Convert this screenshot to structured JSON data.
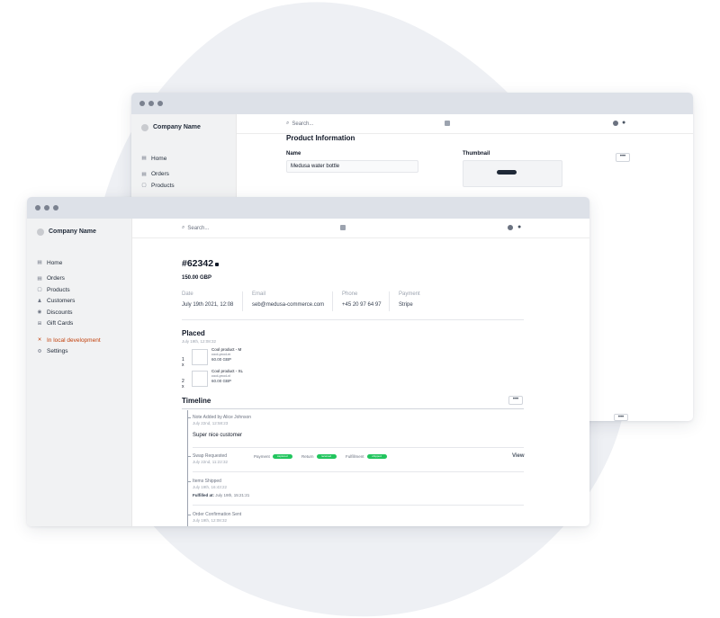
{
  "back_window": {
    "company": "Company Name",
    "search_placeholder": "Search...",
    "nav": [
      "Home",
      "Orders",
      "Products"
    ],
    "section_title": "Product Information",
    "name_label": "Name",
    "name_value": "Medusa water bottle",
    "thumbnail_label": "Thumbnail",
    "more_label": "•••"
  },
  "front_window": {
    "company": "Company Name",
    "search_placeholder": "Search...",
    "nav": {
      "home": "Home",
      "orders": "Orders",
      "products": "Products",
      "customers": "Customers",
      "discounts": "Discounts",
      "gift_cards": "Gift Cards",
      "local_dev": "In local development",
      "settings": "Settings"
    },
    "order": {
      "id": "#62342",
      "total": "150.00 GBP",
      "date_label": "Date",
      "date_value": "July 19th 2021, 12:08",
      "email_label": "Email",
      "email_value": "seb@medusa-commerce.com",
      "phone_label": "Phone",
      "phone_value": "+45 20 97 64 97",
      "payment_label": "Payment",
      "payment_value": "Stripe"
    },
    "placed": {
      "title": "Placed",
      "date": "July 19th, 12:08:32",
      "items": [
        {
          "qty": "1 x",
          "name": "Cool product - M",
          "sku": "cool-prod-m",
          "price": "60.00 GBP"
        },
        {
          "qty": "2 x",
          "name": "Cool product - XL",
          "sku": "cool-prod-xl",
          "price": "60.00 GBP"
        }
      ]
    },
    "timeline": {
      "title": "Timeline",
      "more_label": "•••",
      "events": {
        "note": {
          "title": "Note Added",
          "by": "by Alice Johnson",
          "date": "July 22nd, 12:58:23",
          "text": "Super nice customer"
        },
        "swap": {
          "title": "Swap Requested",
          "date": "July 22nd, 11:22:32",
          "payment_label": "Payment",
          "payment_status": "captured",
          "return_label": "Return",
          "return_status": "received",
          "fulfillment_label": "Fulfillment",
          "fulfillment_status": "shipped",
          "view": "View"
        },
        "shipped": {
          "title": "Items Shipped",
          "date": "July 19th, 16:43:22",
          "fulfilled_label": "Fulfilled at:",
          "fulfilled_value": "July 19th, 15:21:21"
        },
        "confirmation": {
          "title": "Order Confirmation Sent",
          "date": "July 19th, 12:08:32"
        }
      }
    }
  },
  "colors": {
    "blob": "#eef0f4",
    "sidebar": "#f1f2f3",
    "titlebar": "#dde1e8",
    "dev_accent": "#c2410c",
    "status_green": "#22c55e"
  }
}
